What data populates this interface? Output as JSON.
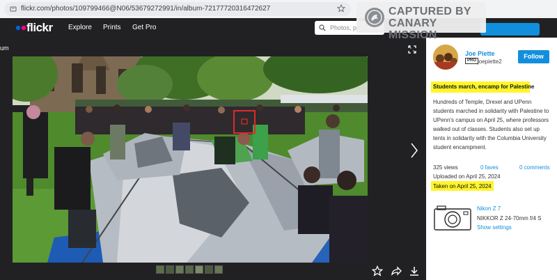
{
  "browser": {
    "url": "flickr.com/photos/109799466@N06/53679272991/in/album-72177720316472627"
  },
  "watermark": {
    "line1": "CAPTURED BY",
    "line2": "CANARY MISSION"
  },
  "header": {
    "logo": "flickr",
    "nav": [
      "Explore",
      "Prints",
      "Get Pro"
    ],
    "search_placeholder": "Photos, pe"
  },
  "stage": {
    "back_label": "um",
    "thumbnail_count": 7
  },
  "sidebar": {
    "username": "Joe Piette",
    "pro_badge": "PRO",
    "handle": "joepiette2",
    "follow_label": "Follow",
    "photo_title": "Students march, encamp for Palestine",
    "description_lines": [
      "Hundreds of Temple, Drexel and UPenn",
      "students marched in solidarity with Palestine to",
      "UPenn's campus on April 25, where professors",
      "walked out of classes. Students also set up",
      "tents in solidarity with the Columbia University",
      "student encampment."
    ],
    "views": "325 views",
    "faves": "0 faves",
    "comments": "0 comments",
    "uploaded": "Uploaded on April 25, 2024",
    "taken": "Taken on April 25, 2024",
    "camera": "Nikon Z 7",
    "lens": "NIKKOR Z 24-70mm f/4 S",
    "show_settings": "Show settings"
  },
  "colors": {
    "accent": "#128fdc",
    "highlight": "#fef52c",
    "dark_bg": "#212124",
    "face_box": "#e02a2a"
  }
}
